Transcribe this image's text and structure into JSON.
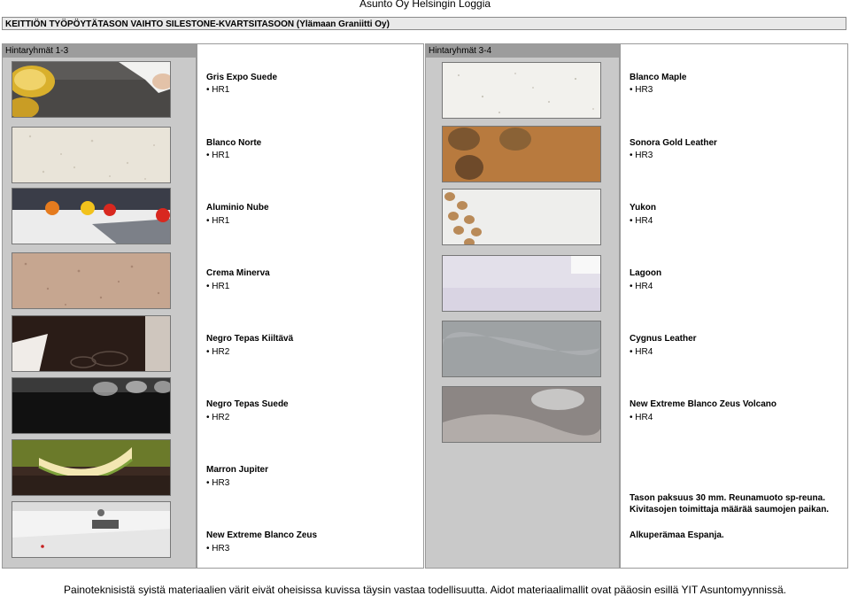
{
  "header": {
    "company": "Asunto Oy Helsingin Loggia",
    "subtitle": "KEITTIÖN TYÖPÖYTÄTASON VAIHTO SILESTONE-KVARTSITASOON (Ylämaan Graniitti Oy)"
  },
  "groups": {
    "left_label": "Hintaryhmät 1-3",
    "right_label": "Hintaryhmät 3-4"
  },
  "left_items": [
    {
      "name": "Gris Expo Suede",
      "code": "• HR1",
      "swatch": "lemon-countertop"
    },
    {
      "name": "Blanco Norte",
      "code": "• HR1",
      "swatch": "speckled-white"
    },
    {
      "name": "Aluminio Nube",
      "code": "• HR1",
      "swatch": "kitchen-peppers"
    },
    {
      "name": "Crema Minerva",
      "code": "• HR1",
      "swatch": "beige-speckle"
    },
    {
      "name": "Negro Tepas Kiiltävä",
      "code": "• HR2",
      "swatch": "black-cooktop"
    },
    {
      "name": "Negro Tepas Suede",
      "code": "• HR2",
      "swatch": "black-glasses"
    },
    {
      "name": "Marron Jupiter",
      "code": "• HR3",
      "swatch": "melon-brown"
    },
    {
      "name": "New Extreme Blanco Zeus",
      "code": "• HR3",
      "swatch": "white-kitchen"
    }
  ],
  "right_items": [
    {
      "name": "Blanco Maple",
      "code": "• HR3",
      "swatch": "white-fleck"
    },
    {
      "name": "Sonora Gold Leather",
      "code": "• HR3",
      "swatch": "walnuts-gold"
    },
    {
      "name": "Yukon",
      "code": "• HR4",
      "swatch": "hazelnuts-white"
    },
    {
      "name": "Lagoon",
      "code": "• HR4",
      "swatch": "lilac-white"
    },
    {
      "name": "Cygnus Leather",
      "code": "• HR4",
      "swatch": "grey-leather"
    },
    {
      "name": "New Extreme Blanco Zeus Volcano",
      "code": "• HR4",
      "swatch": "white-volcano"
    }
  ],
  "notes": {
    "line1": "Tason paksuus 30 mm. Reunamuoto sp-reuna.",
    "line2": "Kivitasojen toimittaja määrää saumojen paikan.",
    "line3": "Alkuperämaa Espanja."
  },
  "footer": "Painoteknisistä syistä materiaalien värit eivät oheisissa kuvissa täysin vastaa todellisuutta. Aidot materiaalimallit ovat pääosin esillä YIT Asuntomyynnissä."
}
